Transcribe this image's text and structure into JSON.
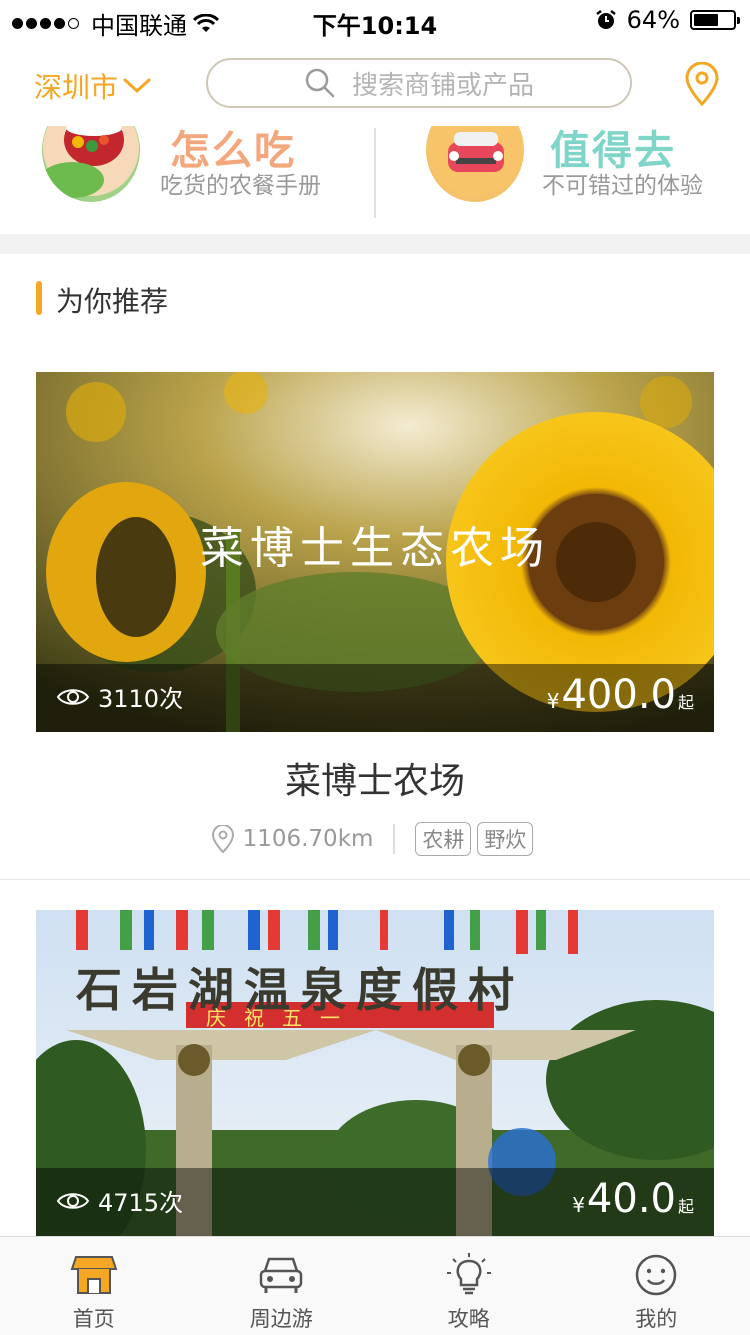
{
  "status": {
    "carrier": "中国联通",
    "time": "下午10:14",
    "battery": "64%",
    "battery_level": 0.64
  },
  "nav": {
    "city": "深圳市",
    "search_placeholder": "搜索商铺或产品"
  },
  "categories": [
    {
      "title": "怎么吃",
      "subtitle": "吃货的农餐手册",
      "title_color": "#f4a67d"
    },
    {
      "title": "值得去",
      "subtitle": "不可错过的体验",
      "title_color": "#7fd6c8"
    }
  ],
  "recommend": {
    "title": "为你推荐"
  },
  "cards": [
    {
      "image_caption": "菜博士生态农场",
      "views": "3110次",
      "price_symbol": "¥",
      "price": "400.0",
      "price_suffix": "起",
      "name": "菜博士农场",
      "distance": "1106.70km",
      "tags": [
        "农耕",
        "野炊"
      ]
    },
    {
      "image_caption": "石岩湖温泉度假村",
      "banner": "庆祝五一",
      "views": "4715次",
      "price_symbol": "¥",
      "price": "40.0",
      "price_suffix": "起"
    }
  ],
  "tabbar": [
    {
      "label": "首页",
      "icon": "shop-icon",
      "active": true
    },
    {
      "label": "周边游",
      "icon": "car-icon",
      "active": false
    },
    {
      "label": "攻略",
      "icon": "lightbulb-icon",
      "active": false
    },
    {
      "label": "我的",
      "icon": "smiley-icon",
      "active": false
    }
  ],
  "colors": {
    "accent": "#f5a623",
    "card_overlay": "rgba(0,0,0,0.45)"
  }
}
